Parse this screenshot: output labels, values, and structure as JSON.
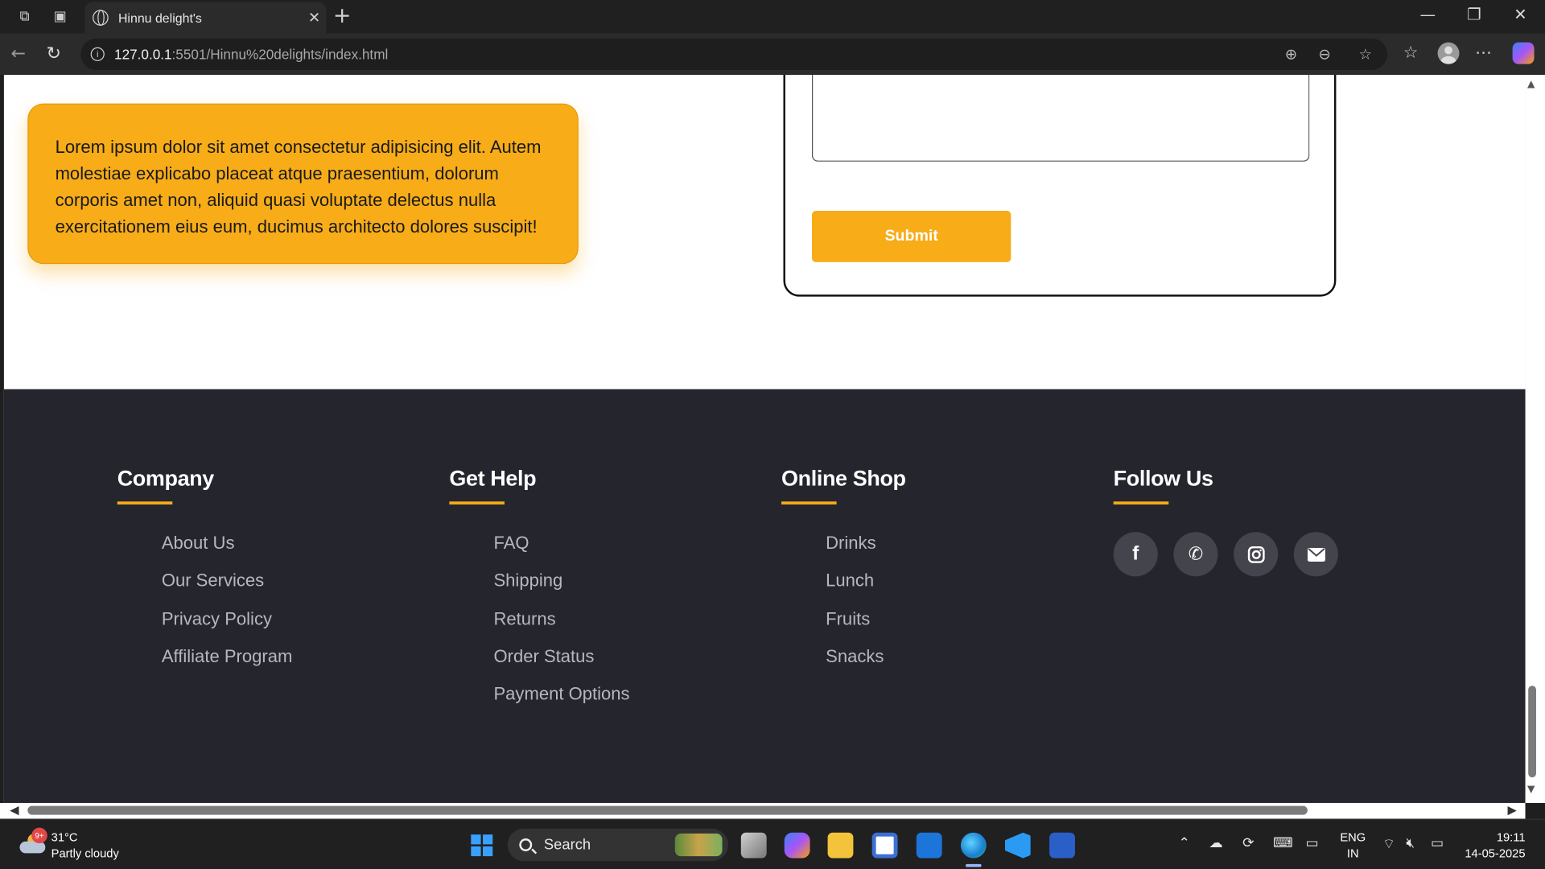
{
  "browser": {
    "tab_title": "Hinnu delight's",
    "url_host": "127.0.0.1",
    "url_path": ":5501/Hinnu%20delights/index.html"
  },
  "page": {
    "quote_text": "Lorem ipsum dolor sit amet consectetur adipisicing elit. Autem molestiae explicabo placeat atque praesentium, dolorum corporis amet non, aliquid quasi voluptate delectus nulla exercitationem eius eum, ducimus architecto dolores suscipit!",
    "submit_label": "Submit"
  },
  "footer": {
    "columns": [
      {
        "title": "Company",
        "links": [
          "About Us",
          "Our Services",
          "Privacy Policy",
          "Affiliate Program"
        ]
      },
      {
        "title": "Get Help",
        "links": [
          "FAQ",
          "Shipping",
          "Returns",
          "Order Status",
          "Payment Options"
        ]
      },
      {
        "title": "Online Shop",
        "links": [
          "Drinks",
          "Lunch",
          "Fruits",
          "Snacks"
        ]
      }
    ],
    "follow_title": "Follow Us",
    "socials": [
      "facebook-icon",
      "phone-icon",
      "instagram-icon",
      "envelope-icon"
    ]
  },
  "colors": {
    "accent": "#f7ac18",
    "footer_bg": "#25252d",
    "social_bg": "#44444c"
  },
  "taskbar": {
    "temperature": "31°C",
    "weather": "Partly cloudy",
    "weather_badge": "9+",
    "search_label": "Search",
    "lang_line1": "ENG",
    "lang_line2": "IN",
    "time": "19:11",
    "date": "14-05-2025"
  }
}
